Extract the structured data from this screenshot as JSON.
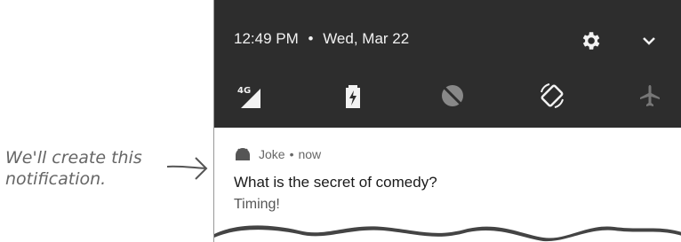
{
  "annotation": {
    "line1": "We'll create this",
    "line2": "notification."
  },
  "status": {
    "time": "12:49 PM",
    "separator": "•",
    "date": "Wed, Mar 22",
    "settings_icon": "gear-icon",
    "expand_icon": "chevron-down-icon"
  },
  "quick_settings": {
    "mobile_data": "4G",
    "tiles": [
      "mobile-signal-icon",
      "battery-saver-icon",
      "data-saver-icon",
      "auto-rotate-icon",
      "airplane-mode-icon"
    ]
  },
  "notification": {
    "app_name": "Joke",
    "separator": "•",
    "time": "now",
    "title": "What is the secret of comedy?",
    "text": "Timing!",
    "app_icon": "android-icon"
  },
  "colors": {
    "panel_bg": "#2d2d2d",
    "panel_text": "#f2f2f2",
    "notification_bg": "#ffffff"
  }
}
